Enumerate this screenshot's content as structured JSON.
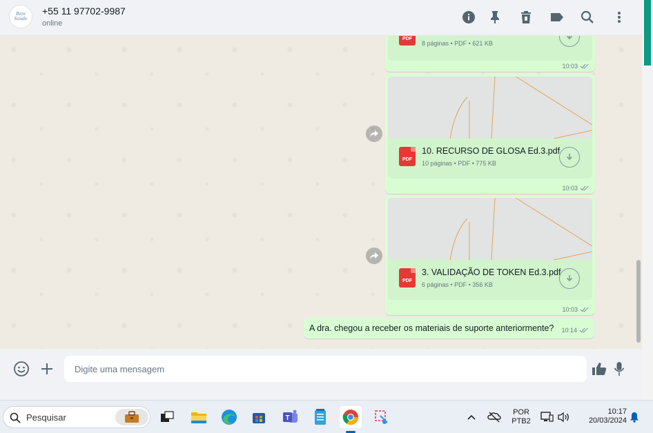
{
  "header": {
    "avatar_text": "Bem Saúde",
    "contact_name": "+55 11 97702-9987",
    "status": "online"
  },
  "messages": {
    "doc1": {
      "meta": "8 páginas • PDF • 621 KB",
      "time": "10:03"
    },
    "doc2": {
      "name": "10. RECURSO DE GLOSA Ed.3.pdf",
      "meta": "10 páginas • PDF • 775 KB",
      "time": "10:03"
    },
    "doc3": {
      "name": "3. VALIDAÇÃO DE TOKEN Ed.3.pdf",
      "meta": "6 páginas • PDF • 356 KB",
      "time": "10:03"
    },
    "text1": {
      "text": "A dra. chegou a receber os materiais de suporte anteriormente?",
      "time": "10:14"
    },
    "pdf_label": "PDF"
  },
  "composer": {
    "placeholder": "Digite uma mensagem"
  },
  "taskbar": {
    "search_label": "Pesquisar",
    "lang": "POR",
    "layout": "PTB2",
    "time": "10:17",
    "date": "20/03/2024"
  },
  "colors": {
    "outgoing_bubble": "#d9fdd3",
    "doc_card": "#d1f4cc",
    "chat_bg": "#efeae2",
    "accent": "#00a884"
  }
}
